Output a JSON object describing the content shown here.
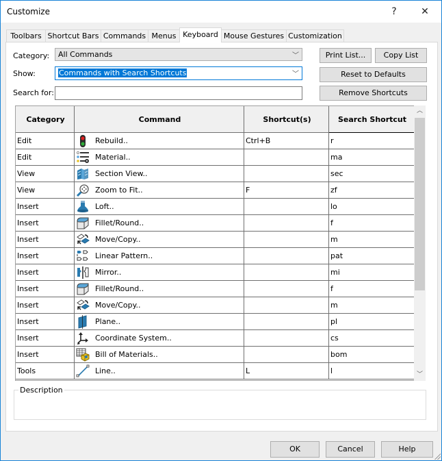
{
  "window": {
    "title": "Customize",
    "help_glyph": "?",
    "close_glyph": "✕"
  },
  "tabs": [
    {
      "label": "Toolbars",
      "active": false
    },
    {
      "label": "Shortcut Bars",
      "active": false
    },
    {
      "label": "Commands",
      "active": false
    },
    {
      "label": "Menus",
      "active": false
    },
    {
      "label": "Keyboard",
      "active": true
    },
    {
      "label": "Mouse Gestures",
      "active": false
    },
    {
      "label": "Customization",
      "active": false
    }
  ],
  "filters": {
    "category_label": "Category:",
    "category_value": "All Commands",
    "show_label": "Show:",
    "show_value": "Commands with Search Shortcuts",
    "search_label": "Search for:",
    "search_value": ""
  },
  "buttons": {
    "print_list": "Print List...",
    "copy_list": "Copy List",
    "reset_defaults": "Reset to Defaults",
    "remove_shortcuts": "Remove Shortcuts",
    "ok": "OK",
    "cancel": "Cancel",
    "help": "Help"
  },
  "table": {
    "columns": [
      "Category",
      "Command",
      "Shortcut(s)",
      "Search Shortcut"
    ],
    "rows": [
      {
        "category": "Edit",
        "icon": "rebuild-icon",
        "command": "Rebuild..",
        "shortcut": "Ctrl+B",
        "search": "r"
      },
      {
        "category": "Edit",
        "icon": "material-icon",
        "command": "Material..",
        "shortcut": "",
        "search": "ma"
      },
      {
        "category": "View",
        "icon": "section-view-icon",
        "command": "Section View..",
        "shortcut": "",
        "search": "sec"
      },
      {
        "category": "View",
        "icon": "zoom-to-fit-icon",
        "command": "Zoom to Fit..",
        "shortcut": "F",
        "search": "zf"
      },
      {
        "category": "Insert",
        "icon": "loft-icon",
        "command": "Loft..",
        "shortcut": "",
        "search": "lo"
      },
      {
        "category": "Insert",
        "icon": "fillet-icon",
        "command": "Fillet/Round..",
        "shortcut": "",
        "search": "f"
      },
      {
        "category": "Insert",
        "icon": "move-copy-icon",
        "command": "Move/Copy..",
        "shortcut": "",
        "search": "m"
      },
      {
        "category": "Insert",
        "icon": "linear-pattern-icon",
        "command": "Linear Pattern..",
        "shortcut": "",
        "search": "pat"
      },
      {
        "category": "Insert",
        "icon": "mirror-icon",
        "command": "Mirror..",
        "shortcut": "",
        "search": "mi"
      },
      {
        "category": "Insert",
        "icon": "fillet-icon",
        "command": "Fillet/Round..",
        "shortcut": "",
        "search": "f"
      },
      {
        "category": "Insert",
        "icon": "move-copy-icon",
        "command": "Move/Copy..",
        "shortcut": "",
        "search": "m"
      },
      {
        "category": "Insert",
        "icon": "plane-icon",
        "command": "Plane..",
        "shortcut": "",
        "search": "pl"
      },
      {
        "category": "Insert",
        "icon": "coordinate-system-icon",
        "command": "Coordinate System..",
        "shortcut": "",
        "search": "cs"
      },
      {
        "category": "Insert",
        "icon": "bill-of-materials-icon",
        "command": "Bill of Materials..",
        "shortcut": "",
        "search": "bom"
      },
      {
        "category": "Tools",
        "icon": "line-icon",
        "command": "Line..",
        "shortcut": "L",
        "search": "l"
      }
    ]
  },
  "description": {
    "label": "Description",
    "text": ""
  },
  "colors": {
    "accent": "#0078d7",
    "window_border": "#1883d7",
    "icon_blue": "#2a7bb0"
  }
}
